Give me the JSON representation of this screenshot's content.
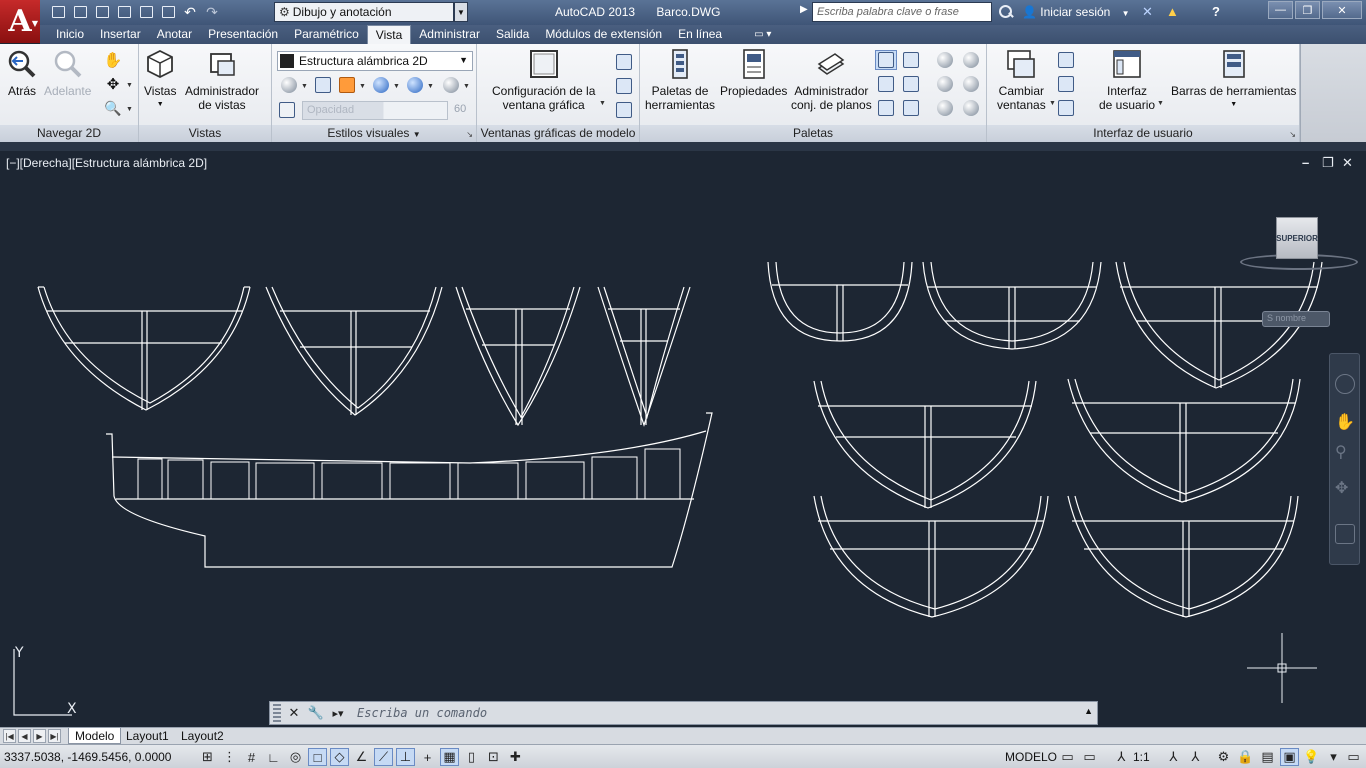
{
  "titlebar": {
    "app_letter": "A",
    "workspace": "Dibujo y anotación",
    "app_name": "AutoCAD 2013",
    "file_name": "Barco.DWG",
    "search_placeholder": "Escriba palabra clave o frase",
    "signin": "Iniciar sesión",
    "help": "?"
  },
  "ribbon_tabs": [
    "Inicio",
    "Insertar",
    "Anotar",
    "Presentación",
    "Paramétrico",
    "Vista",
    "Administrar",
    "Salida",
    "Módulos de extensión",
    "En línea"
  ],
  "active_tab": "Vista",
  "panels": {
    "navegar": {
      "title": "Navegar 2D",
      "back": "Atrás",
      "forward": "Adelante"
    },
    "vistas": {
      "title": "Vistas",
      "views": "Vistas",
      "view_manager_l1": "Administrador",
      "view_manager_l2": "de vistas"
    },
    "estilos": {
      "title": "Estilos visuales",
      "current": "Estructura alámbrica 2D",
      "opacity_label": "Opacidad",
      "opacity_value": "60"
    },
    "ventanas": {
      "title": "Ventanas gráficas de modelo",
      "config_l1": "Configuración de la",
      "config_l2": "ventana gráfica"
    },
    "paletas": {
      "title": "Paletas",
      "tool_palettes_l1": "Paletas de",
      "tool_palettes_l2": "herramientas",
      "properties": "Propiedades",
      "sheetset_l1": "Administrador",
      "sheetset_l2": "conj. de planos"
    },
    "interfaz": {
      "title": "Interfaz de usuario",
      "switch_l1": "Cambiar",
      "switch_l2": "ventanas",
      "ui_l1": "Interfaz",
      "ui_l2": "de usuario",
      "toolbars": "Barras de herramientas"
    }
  },
  "viewport": {
    "label": "[−][Derecha][Estructura alámbrica 2D]",
    "viewcube": "SUPERIOR",
    "wcs": "S nombre",
    "ucs_x": "X",
    "ucs_y": "Y"
  },
  "command": {
    "placeholder": "Escriba un comando"
  },
  "layout_tabs": [
    "Modelo",
    "Layout1",
    "Layout2"
  ],
  "active_layout": "Modelo",
  "status": {
    "coords": "3337.5038, -1469.5456, 0.0000",
    "model": "MODELO",
    "scale": "1:1"
  }
}
